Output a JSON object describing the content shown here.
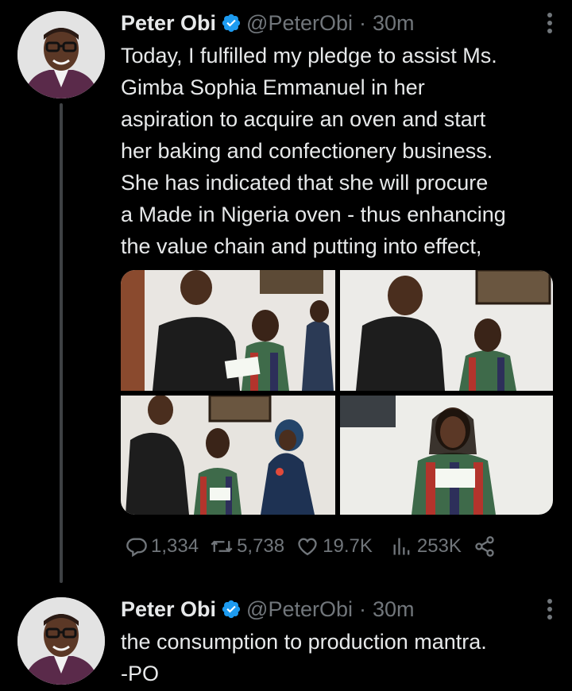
{
  "tweets": [
    {
      "name": "Peter Obi",
      "handle": "@PeterObi",
      "separator": "·",
      "time": "30m",
      "text": "Today, I fulfilled my pledge to assist Ms.\nGimba Sophia Emmanuel in her\naspiration to acquire an oven and start\nher baking and confectionery business.\nShe has indicated that she will procure\na Made in Nigeria oven - thus enhancing\nthe value chain and putting into effect,",
      "stats": {
        "replies": "1,334",
        "retweets": "5,738",
        "likes": "19.7K",
        "views": "253K"
      }
    },
    {
      "name": "Peter Obi",
      "handle": "@PeterObi",
      "separator": "·",
      "time": "30m",
      "text": "the consumption to production mantra.\n-PO"
    }
  ],
  "icons": {
    "verified": "verified-badge-icon",
    "more": "more-vertical-icon",
    "reply": "reply-icon",
    "retweet": "retweet-icon",
    "like": "heart-icon",
    "views": "views-icon",
    "share": "share-icon"
  },
  "colors": {
    "background": "#000000",
    "text": "#e7e9ea",
    "secondary": "#71767b",
    "verified": "#1d9bf0",
    "thread_line": "#3e4144"
  }
}
